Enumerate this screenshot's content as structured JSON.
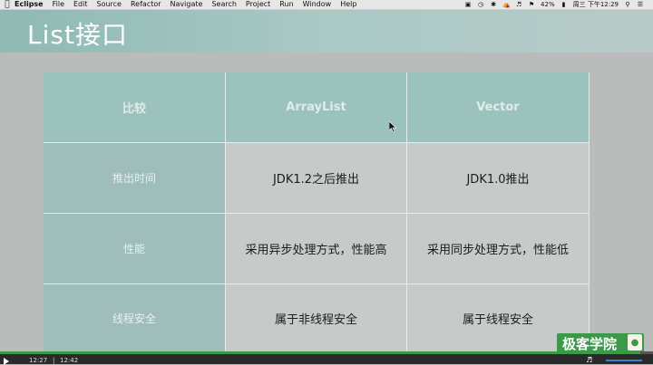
{
  "menubar": {
    "apple_icon": "apple-icon",
    "app_name": "Eclipse",
    "menus": [
      "File",
      "Edit",
      "Source",
      "Refactor",
      "Navigate",
      "Search",
      "Project",
      "Run",
      "Window",
      "Help"
    ],
    "battery": "42%",
    "clock": "周三 下午12:29"
  },
  "slide": {
    "title": "List接口",
    "table": {
      "headers": [
        "比较",
        "ArrayList",
        "Vector"
      ],
      "rows": [
        [
          "推出时间",
          "JDK1.2之后推出",
          "JDK1.0推出"
        ],
        [
          "性能",
          "采用异步处理方式，性能高",
          "采用同步处理方式，性能低"
        ],
        [
          "线程安全",
          "属于非线程安全",
          "属于线程安全"
        ]
      ]
    }
  },
  "watermark": {
    "text": "极客学院"
  },
  "player": {
    "current_time": "12:27",
    "total_time": "12:42",
    "progress": 0.98
  },
  "colors": {
    "title_band": "#8fb9b4",
    "header_cell": "#9cc2bd",
    "row_header_cell": "#9fbebb",
    "body_cell": "#c6cac9",
    "watermark": "#3b9a4a",
    "progress_fill": "#3a9a48"
  }
}
